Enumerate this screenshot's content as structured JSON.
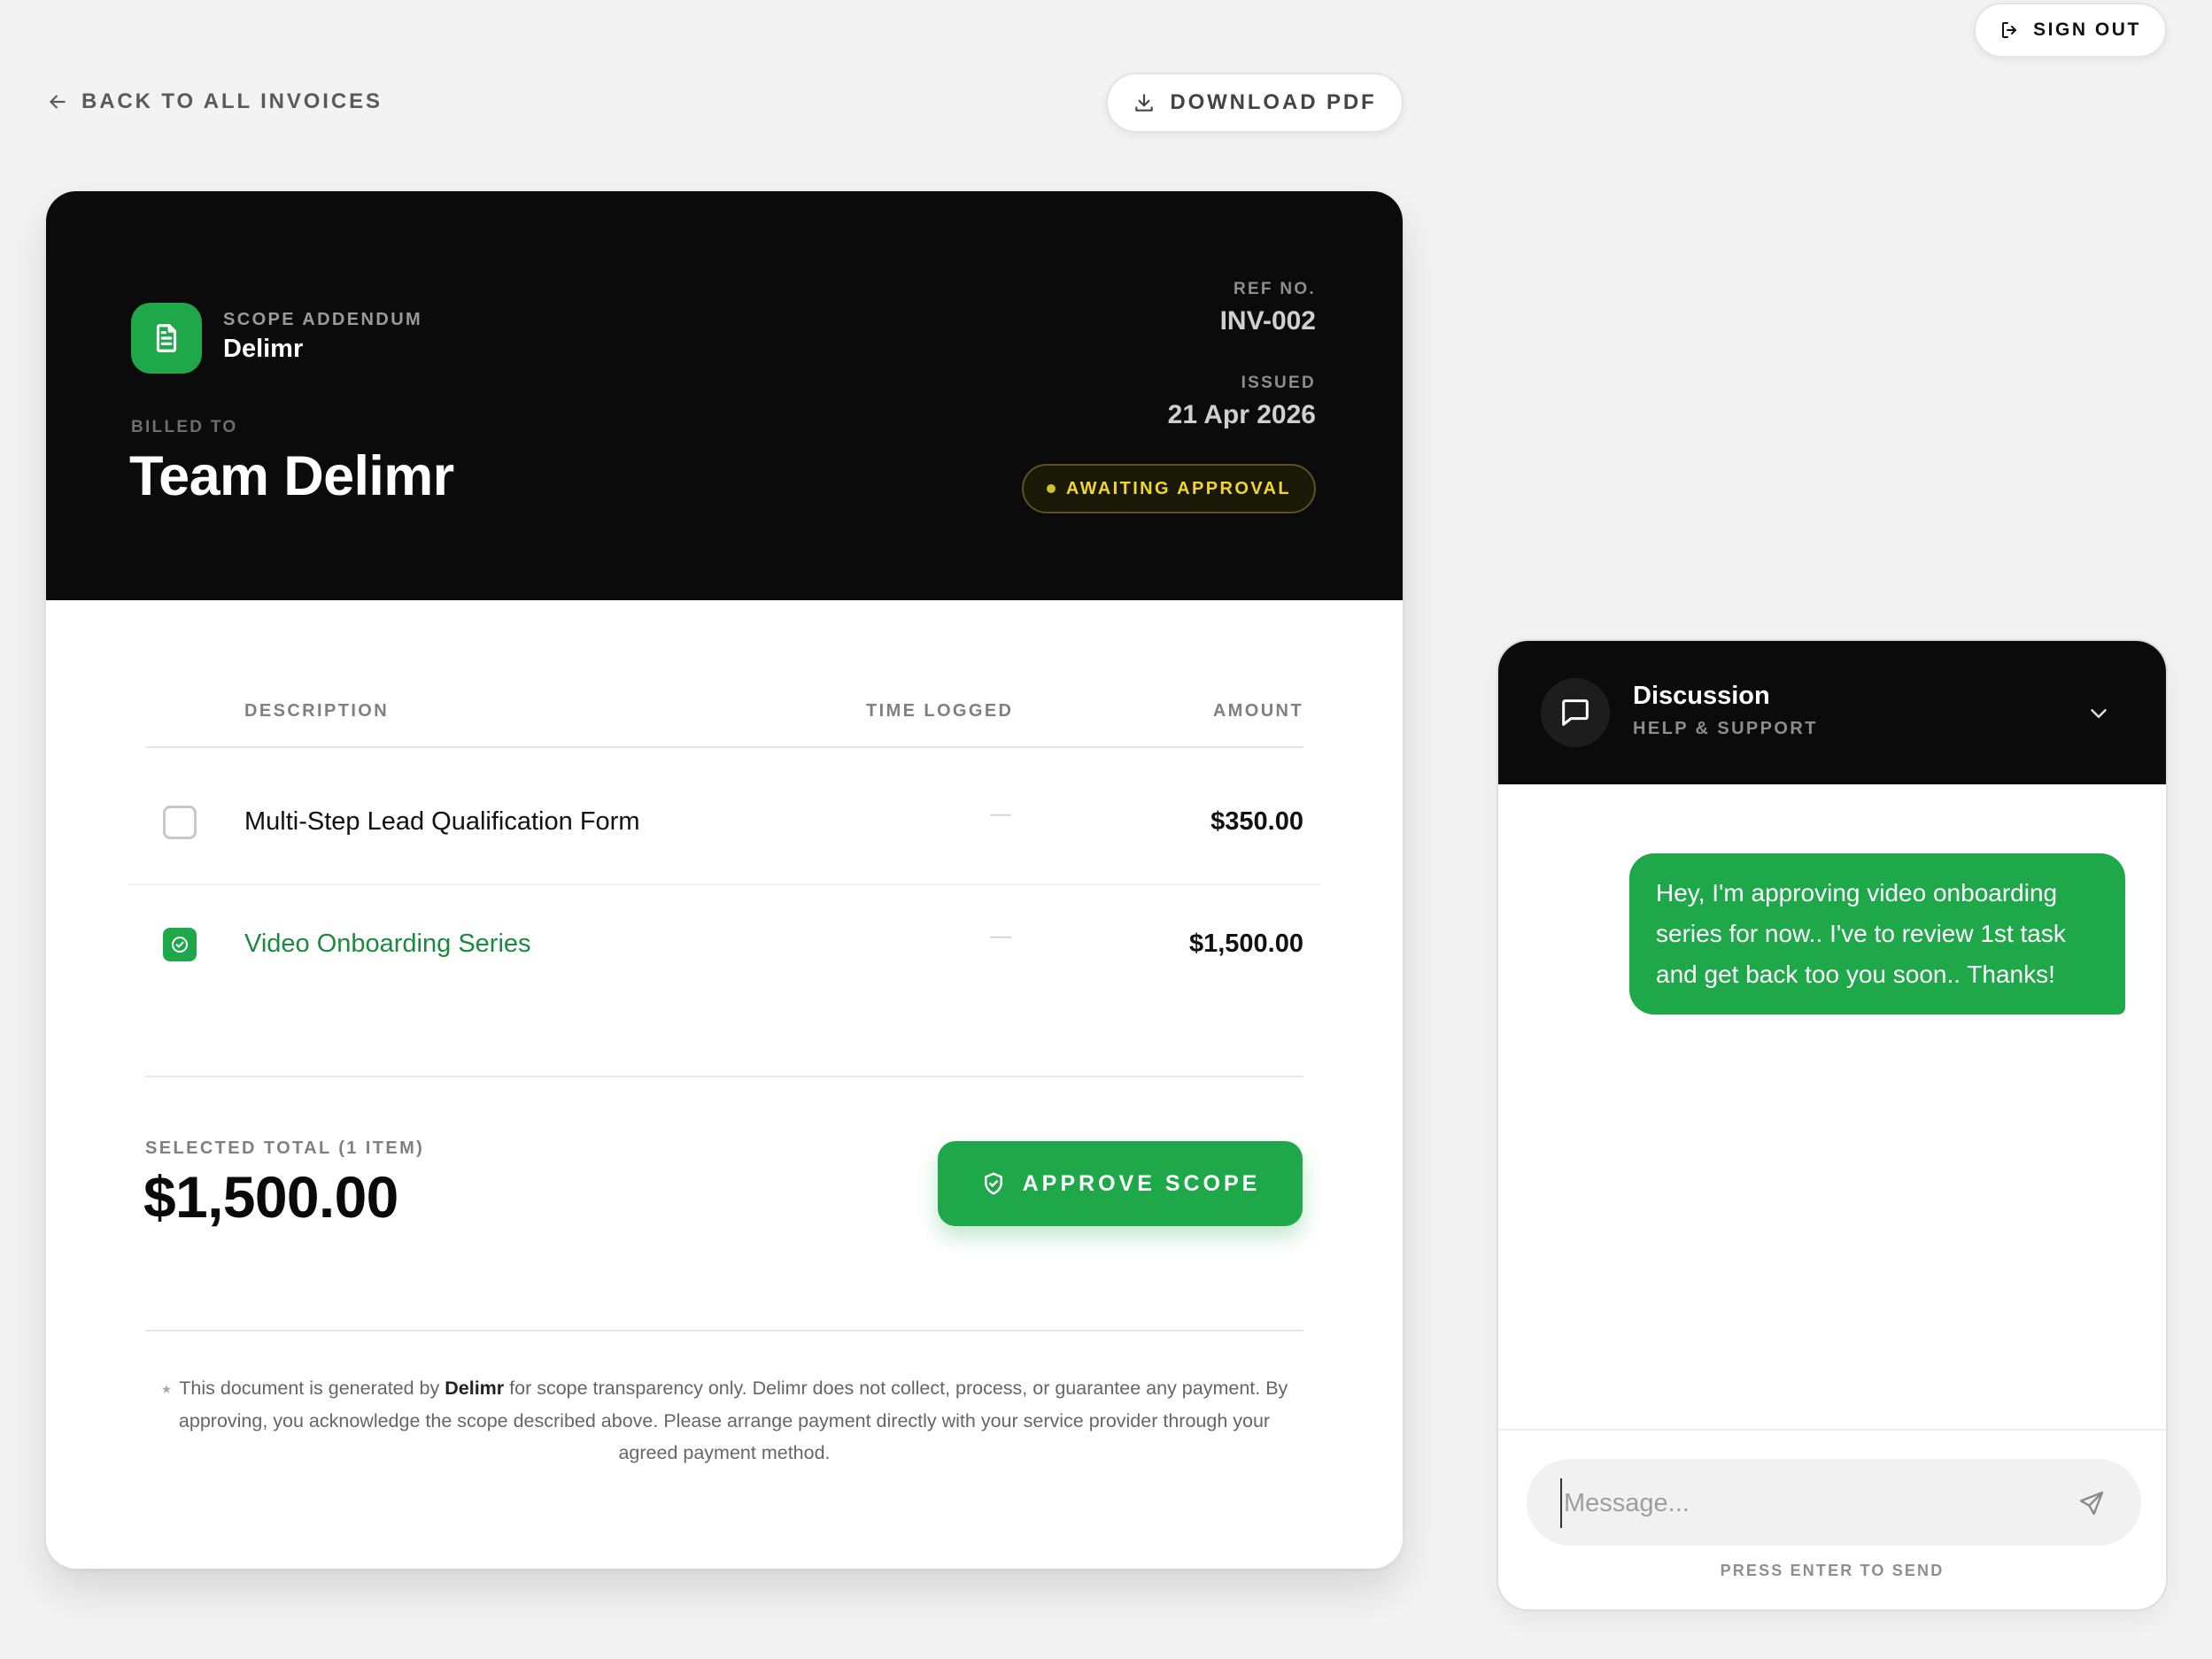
{
  "topbar": {
    "sign_out_label": "SIGN OUT",
    "back_label": "BACK TO ALL INVOICES",
    "download_label": "DOWNLOAD PDF"
  },
  "invoice": {
    "kind_label": "SCOPE ADDENDUM",
    "brand": "Delimr",
    "billed_to_label": "BILLED TO",
    "client": "Team Delimr",
    "ref_label": "REF NO.",
    "ref_value": "INV-002",
    "issued_label": "ISSUED",
    "issued_value": "21 Apr 2026",
    "status": "AWAITING APPROVAL",
    "status_color": "#f0d72e",
    "columns": [
      "DESCRIPTION",
      "TIME LOGGED",
      "AMOUNT"
    ],
    "items": [
      {
        "description": "Multi-Step Lead Qualification Form",
        "time_logged": "—",
        "amount": "$350.00",
        "selected": false
      },
      {
        "description": "Video Onboarding Series",
        "time_logged": "—",
        "amount": "$1,500.00",
        "selected": true
      }
    ],
    "selected_total_label": "SELECTED TOTAL (1 ITEM)",
    "selected_total": "$1,500.00",
    "approve_label": "APPROVE SCOPE",
    "footnote": {
      "star": "★",
      "before": "This document is generated by ",
      "brand": "Delimr",
      "after": " for scope transparency only. Delimr does not collect, process, or guarantee any payment. By approving, you acknowledge the scope described above. Please arrange payment directly with your service provider through your agreed payment method."
    },
    "accent_color": "#1fa84a"
  },
  "chat": {
    "title": "Discussion",
    "subtitle": "HELP & SUPPORT",
    "messages": [
      {
        "from": "me",
        "text": "Hey, I'm approving video onboarding series for now.. I've to review 1st task and get back too you soon.. Thanks!"
      }
    ],
    "input_placeholder": "Message...",
    "hint": "PRESS ENTER TO SEND"
  },
  "icons": {
    "sign_out": "sign-out-icon",
    "back": "arrow-left-icon",
    "download": "download-icon",
    "document": "document-icon",
    "check": "check-circle-icon",
    "shield": "shield-check-icon",
    "chat": "chat-bubble-icon",
    "chevron": "chevron-down-icon",
    "send": "send-icon"
  }
}
